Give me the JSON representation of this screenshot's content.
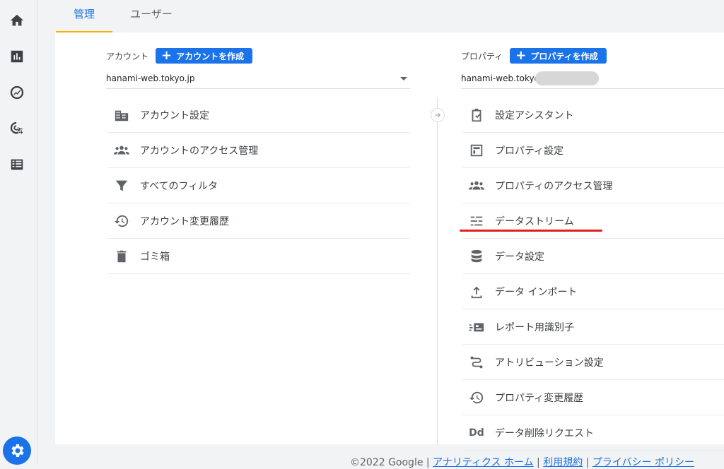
{
  "tabs": [
    {
      "label": "管理",
      "active": true
    },
    {
      "label": "ユーザー",
      "active": false
    }
  ],
  "rail": {
    "icons": [
      "home-icon",
      "reports-icon",
      "explore-icon",
      "advertising-icon",
      "configure-icon"
    ],
    "settings_icon": "gear-icon"
  },
  "account": {
    "heading": "アカウント",
    "create_label": "アカウントを作成",
    "selected": "hanami-web.tokyo.jp",
    "items": [
      {
        "label": "アカウント設定",
        "icon": "building-icon"
      },
      {
        "label": "アカウントのアクセス管理",
        "icon": "people-icon"
      },
      {
        "label": "すべてのフィルタ",
        "icon": "filter-icon"
      },
      {
        "label": "アカウント変更履歴",
        "icon": "history-icon"
      },
      {
        "label": "ゴミ箱",
        "icon": "trash-icon"
      }
    ]
  },
  "property": {
    "heading": "プロパティ",
    "create_label": "プロパティを作成",
    "selected": "hanami-web.tokyo.jp",
    "items": [
      {
        "label": "設定アシスタント",
        "icon": "checklist-icon"
      },
      {
        "label": "プロパティ設定",
        "icon": "layout-icon"
      },
      {
        "label": "プロパティのアクセス管理",
        "icon": "people-icon"
      },
      {
        "label": "データストリーム",
        "icon": "stream-icon",
        "highlighted": true
      },
      {
        "label": "データ設定",
        "icon": "database-icon"
      },
      {
        "label": "データ インポート",
        "icon": "upload-icon"
      },
      {
        "label": "レポート用識別子",
        "icon": "id-card-icon"
      },
      {
        "label": "アトリビューション設定",
        "icon": "attribution-icon"
      },
      {
        "label": "プロパティ変更履歴",
        "icon": "history-icon"
      },
      {
        "label": "データ削除リクエスト",
        "icon": "dd-icon",
        "icon_text": "Dd"
      }
    ]
  },
  "footer": {
    "copyright": "©2022 Google",
    "sep": " | ",
    "links": [
      "アナリティクス ホーム",
      "利用規約",
      "プライバシー ポリシー"
    ]
  },
  "colors": {
    "accent": "#1a73e8",
    "tab_indicator": "#f4b400",
    "highlight_underline": "#e0201b"
  }
}
